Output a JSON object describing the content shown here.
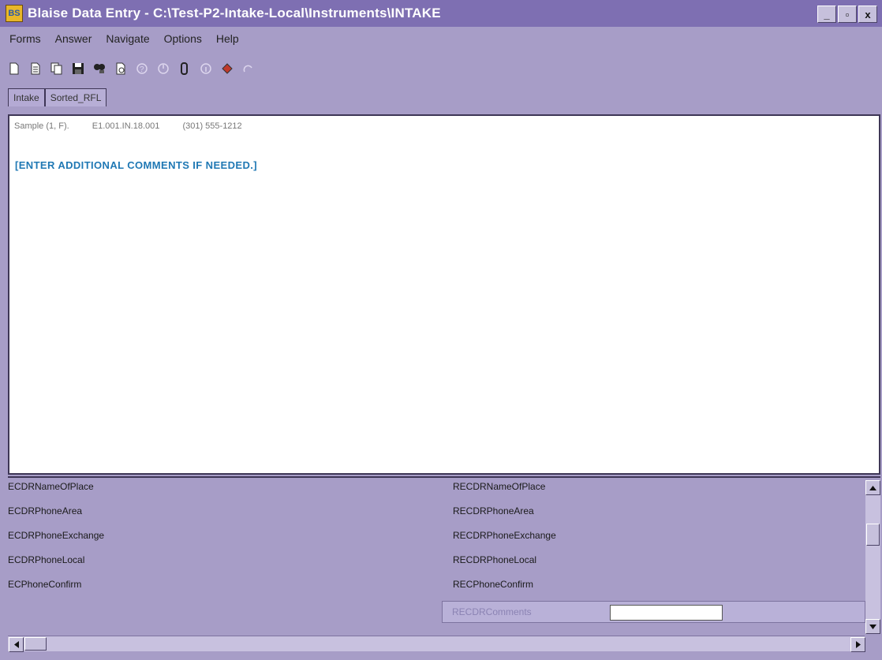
{
  "window": {
    "title": "Blaise Data Entry - C:\\Test-P2-Intake-Local\\Instruments\\INTAKE",
    "icon_text": "BS",
    "controls": [
      "_",
      "▫",
      "x"
    ]
  },
  "menu": [
    "Forms",
    "Answer",
    "Navigate",
    "Options",
    "Help"
  ],
  "toolbar": {
    "icons": [
      "new-icon",
      "open-icon",
      "copy-icon",
      "save-icon",
      "find-icon",
      "print-icon",
      "help-icon",
      "undo-icon",
      "attach-icon",
      "info-icon",
      "book-icon",
      "redo-icon"
    ]
  },
  "tabs": [
    {
      "label": "Intake",
      "active": true
    },
    {
      "label": "Sorted_RFL",
      "active": false
    }
  ],
  "panel": {
    "sample_fields": [
      "Sample (1, F).",
      "E1.001.IN.18.001",
      "(301) 555-1212"
    ],
    "instruction": "[ENTER ADDITIONAL COMMENTS IF NEEDED.]"
  },
  "fields": [
    {
      "left": "ECDRNameOfPlace",
      "right": "RECDRNameOfPlace"
    },
    {
      "left": "ECDRPhoneArea",
      "right": "RECDRPhoneArea"
    },
    {
      "left": "ECDRPhoneExchange",
      "right": "RECDRPhoneExchange"
    },
    {
      "left": "ECDRPhoneLocal",
      "right": "RECDRPhoneLocal"
    },
    {
      "left": "ECPhoneConfirm",
      "right": "RECPhoneConfirm"
    }
  ],
  "active_field": {
    "label": "RECDRComments",
    "value": ""
  }
}
